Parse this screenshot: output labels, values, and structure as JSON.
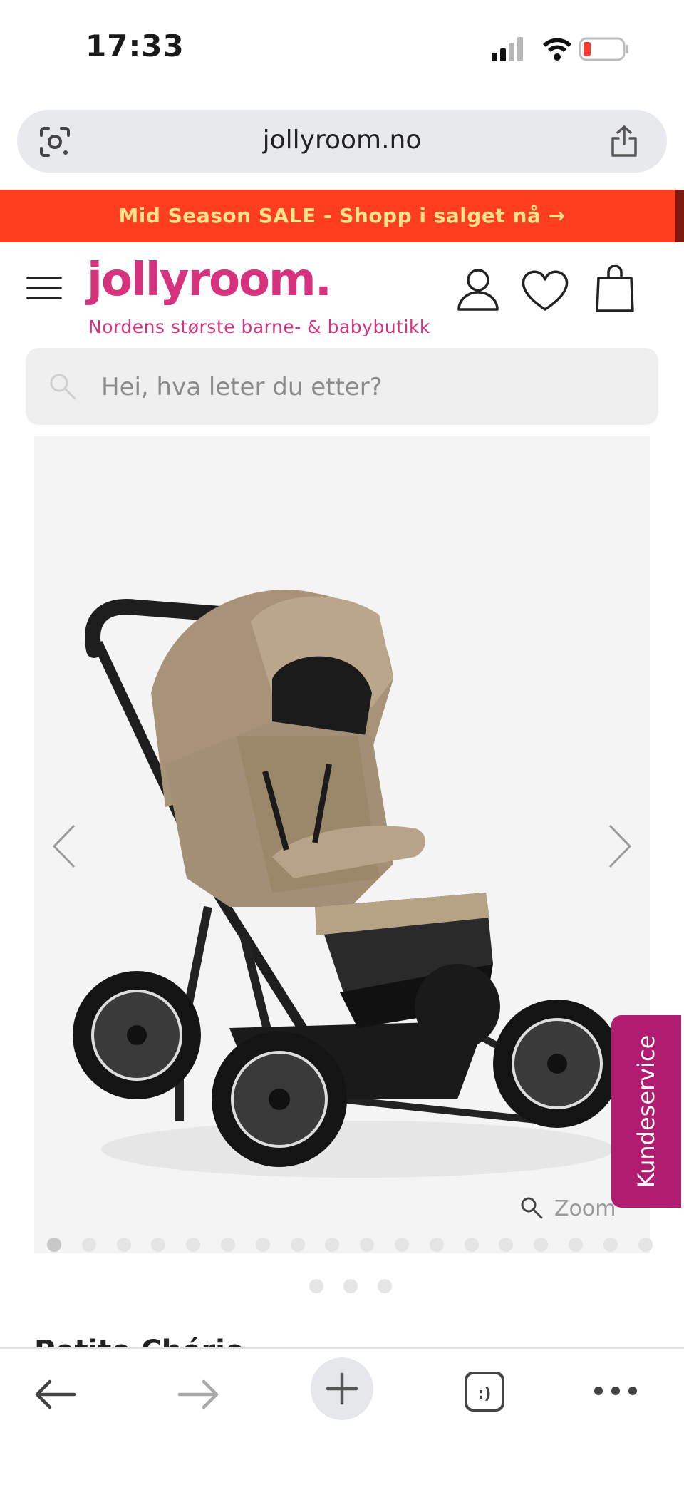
{
  "status_bar": {
    "time": "17:33",
    "icons": [
      "cellular-signal-icon",
      "wifi-icon",
      "battery-low-icon"
    ],
    "battery_color": "#ff3b30"
  },
  "browser": {
    "url": "jollyroom.no",
    "icons": [
      "google-lens-icon",
      "share-icon"
    ]
  },
  "promo": {
    "text": "Mid Season SALE - Shopp i salget nå →",
    "background": "#ff3d1f",
    "text_color": "#ffe28a"
  },
  "header": {
    "logo": "jollyroom.",
    "tagline": "Nordens største barne- & babybutikk",
    "brand_color": "#d6327d",
    "icons": [
      "menu-icon",
      "account-icon",
      "wishlist-icon",
      "cart-icon"
    ]
  },
  "search": {
    "placeholder": "Hei, hva leter du etter?"
  },
  "product": {
    "zoom_label": "Zoom",
    "gallery_image_count": 18,
    "gallery_active_index": 0,
    "secondary_pager_count": 3,
    "title_partial": "Petite Chérie"
  },
  "support": {
    "label": "Kundeservice",
    "color": "#b01c6f"
  },
  "toolbar": {
    "tabs_label": ":)",
    "icons": [
      "back-arrow-icon",
      "forward-arrow-icon",
      "plus-icon",
      "tabs-icon",
      "more-icon"
    ]
  }
}
